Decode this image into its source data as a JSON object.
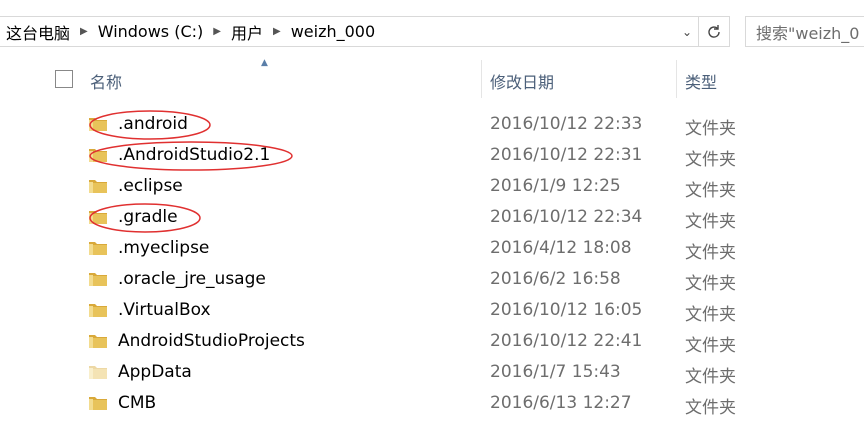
{
  "address_bar": {
    "crumbs": [
      "这台电脑",
      "Windows (C:)",
      "用户",
      "weizh_000"
    ],
    "refresh_icon": "refresh-icon",
    "dropdown_icon": "chevron-down-icon"
  },
  "search": {
    "placeholder": "搜索\"weizh_0"
  },
  "columns": {
    "name": "名称",
    "date": "修改日期",
    "type": "类型"
  },
  "rows": [
    {
      "name": ".android",
      "date": "2016/10/12 22:33",
      "type": "文件夹",
      "icon": "folder-icon",
      "annotated": true
    },
    {
      "name": ".AndroidStudio2.1",
      "date": "2016/10/12 22:31",
      "type": "文件夹",
      "icon": "folder-icon",
      "annotated": true
    },
    {
      "name": ".eclipse",
      "date": "2016/1/9 12:25",
      "type": "文件夹",
      "icon": "folder-icon",
      "annotated": false
    },
    {
      "name": ".gradle",
      "date": "2016/10/12 22:34",
      "type": "文件夹",
      "icon": "folder-icon",
      "annotated": true
    },
    {
      "name": ".myeclipse",
      "date": "2016/4/12 18:08",
      "type": "文件夹",
      "icon": "folder-icon",
      "annotated": false
    },
    {
      "name": ".oracle_jre_usage",
      "date": "2016/6/2 16:58",
      "type": "文件夹",
      "icon": "folder-icon",
      "annotated": false
    },
    {
      "name": ".VirtualBox",
      "date": "2016/10/12 16:05",
      "type": "文件夹",
      "icon": "folder-icon",
      "annotated": false
    },
    {
      "name": "AndroidStudioProjects",
      "date": "2016/10/12 22:41",
      "type": "文件夹",
      "icon": "folder-icon",
      "annotated": false
    },
    {
      "name": "AppData",
      "date": "2016/1/7 15:43",
      "type": "文件夹",
      "icon": "hidden-folder-icon",
      "annotated": false
    },
    {
      "name": "CMB",
      "date": "2016/6/13 12:27",
      "type": "文件夹",
      "icon": "folder-icon",
      "annotated": false
    }
  ],
  "colors": {
    "folder": "#e8c35a",
    "folder_dark": "#d9a93a",
    "annotation": "#e03030",
    "header_text": "#4c607a"
  }
}
